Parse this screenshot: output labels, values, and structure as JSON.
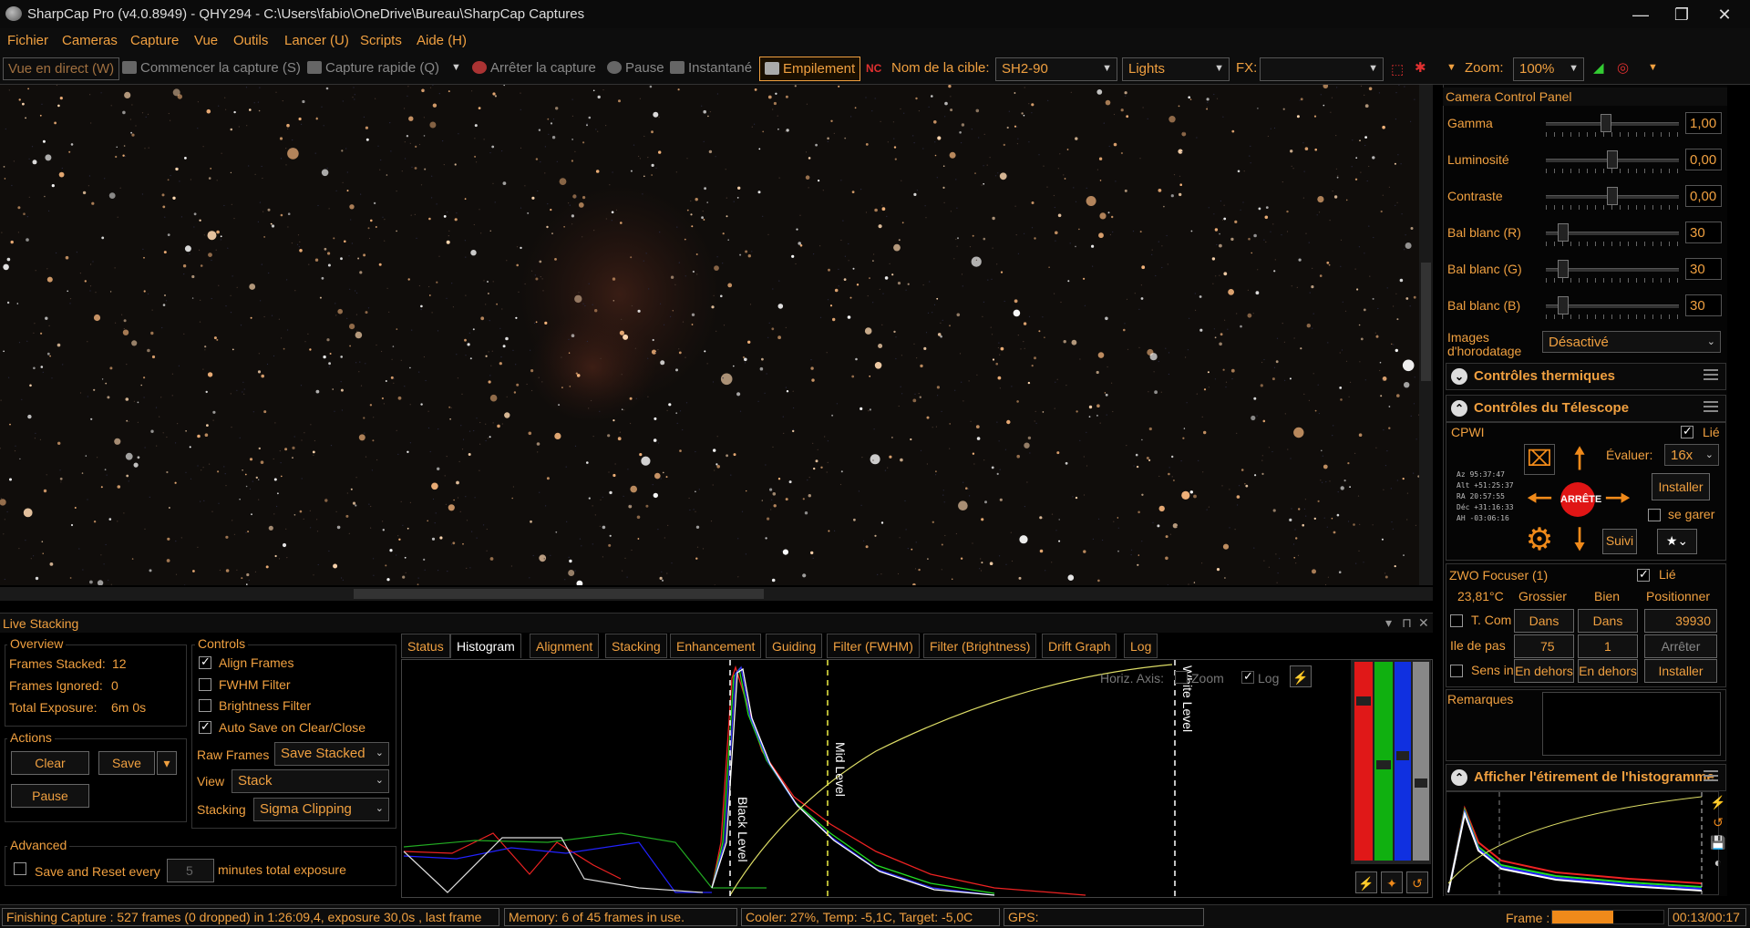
{
  "titlebar": {
    "title": "SharpCap Pro (v4.0.8949) - QHY294 - C:\\Users\\fabio\\OneDrive\\Bureau\\SharpCap Captures",
    "min": "—",
    "max": "❐",
    "close": "✕"
  },
  "menu": [
    "Fichier",
    "Cameras",
    "Capture",
    "Vue",
    "Outils",
    "Lancer (U)",
    "Scripts",
    "Aide (H)"
  ],
  "toolbar": {
    "live_view": "Vue en direct (W)",
    "start_capture": "Commencer la capture (S)",
    "quick_capture": "Capture rapide (Q)",
    "stop_capture": "Arrêter la capture",
    "pause": "Pause",
    "snapshot": "Instantané",
    "stacking": "Empilement",
    "target_label": "Nom de la cible:",
    "target_value": "SH2-90",
    "frame_type": "Lights",
    "fx_label": "FX:",
    "fx_value": "",
    "zoom_label": "Zoom:",
    "zoom_value": "100%"
  },
  "camera_panel": {
    "title": "Camera Control Panel",
    "controls": [
      {
        "label": "Gamma",
        "value": "1,00",
        "level": 0.45
      },
      {
        "label": "Luminosité",
        "value": "0,00",
        "level": 0.5
      },
      {
        "label": "Contraste",
        "value": "0,00",
        "level": 0.5
      },
      {
        "label": "Bal blanc (R)",
        "value": "30",
        "level": 0.1
      },
      {
        "label": "Bal blanc (G)",
        "value": "30",
        "level": 0.1
      },
      {
        "label": "Bal blanc (B)",
        "value": "30",
        "level": 0.1
      }
    ],
    "timestamp_label_1": "Images",
    "timestamp_label_2": "d'horodatage",
    "timestamp_value": "Désactivé"
  },
  "thermal": {
    "title": "Contrôles thermiques"
  },
  "telescope": {
    "title": "Contrôles du Télescope",
    "mount": "CPWI",
    "linked": "Lié",
    "evaluate_label": "Évaluer:",
    "rate": "16x",
    "install": "Installer",
    "park": "se garer",
    "track": "Suivi",
    "stop": "ARRÊTE",
    "coords": [
      "Az   95:37:47",
      "Alt +51:25:37",
      "RA   20:57:55",
      "Déc +31:16:33",
      "AH  -03:06:16"
    ]
  },
  "focuser": {
    "title": "ZWO Focuser (1)",
    "linked": "Lié",
    "temp": "23,81°C",
    "coarse": "Grossier",
    "fine": "Bien",
    "position": "Positionner",
    "temp_comp": "T. Com",
    "in": "Dans",
    "position_value": "39930",
    "step_label": "Ile de pas",
    "coarse_step": "75",
    "fine_step": "1",
    "stop": "Arrêter",
    "direction_label": "Sens in",
    "out": "En dehors",
    "install": "Installer"
  },
  "remarks": {
    "label": "Remarques"
  },
  "histstretch": {
    "title": "Afficher l'étirement de l'histogramme"
  },
  "live_stacking": {
    "title": "Live Stacking",
    "overview": {
      "title": "Overview",
      "stacked_label": "Frames Stacked:",
      "stacked": "12",
      "ignored_label": "Frames Ignored:",
      "ignored": "0",
      "exposure_label": "Total Exposure:",
      "exposure": "6m 0s"
    },
    "controls": {
      "title": "Controls",
      "align": "Align Frames",
      "fwhm": "FWHM Filter",
      "brightness": "Brightness Filter",
      "autosave": "Auto Save on Clear/Close",
      "raw_label": "Raw Frames",
      "raw_value": "Save Stacked",
      "view_label": "View",
      "view_value": "Stack",
      "stacking_label": "Stacking",
      "stacking_value": "Sigma Clipping"
    },
    "actions": {
      "title": "Actions",
      "clear": "Clear",
      "save": "Save",
      "pause": "Pause"
    },
    "advanced": {
      "title": "Advanced",
      "save_reset": "Save and Reset every",
      "minutes": "5",
      "minutes_suffix": "minutes total exposure"
    },
    "tabs": [
      "Status",
      "Histogram",
      "Alignment",
      "Stacking",
      "Enhancement",
      "Guiding",
      "Filter (FWHM)",
      "Filter (Brightness)",
      "Drift Graph",
      "Log"
    ],
    "histogram": {
      "horiz_axis": "Horiz. Axis:",
      "zoom": "Zoom",
      "log": "Log",
      "black_level": "Black Level",
      "mid_level": "Mid Level",
      "white_level": "White Level"
    }
  },
  "status": {
    "message": "Finishing Capture : 527 frames (0 dropped) in 1:26:09,4, exposure 30,0s , last frame",
    "memory": "Memory: 6 of 45 frames in use.",
    "cooler": "Cooler: 27%, Temp: -5,1C, Target: -5,0C",
    "gps": "GPS:",
    "frame_label": "Frame :",
    "frame_progress": 0.55,
    "time": "00:13/00:17"
  },
  "colors": {
    "accent": "#f0a040",
    "bg": "#000000"
  }
}
